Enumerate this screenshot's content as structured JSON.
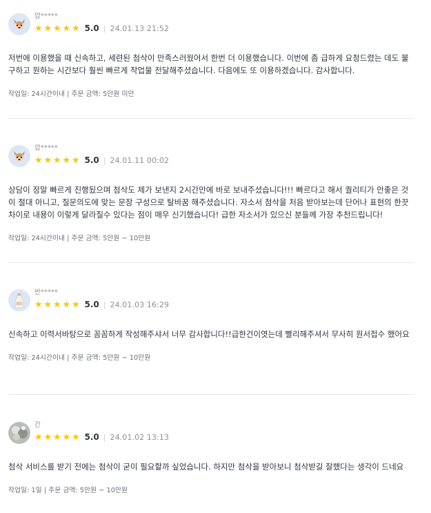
{
  "reviews": [
    {
      "user": "얍*****",
      "avatar": "dog-avatar-icon",
      "score": "5.0",
      "date": "24.01.13 21:52",
      "content": "저번에 이용했을 때 신속하고, 세련된 첨삭이 만족스러웠어서 한번 더 이용했습니다. 이번에 좀 급하게 요청드렸는 데도 불구하고 원하는 시간보다 훨씬 빠르게 작업물 전달해주셨습니다. 다음에도 또 이용하겠습니다. 감사합니다.",
      "info": "작업일: 24시간이내 | 주문 금액: 5만원 미만"
    },
    {
      "user": "얍*****",
      "avatar": "dog-avatar-icon",
      "score": "5.0",
      "date": "24.01.11 00:02",
      "content": "상담이 정말 빠르게 진행됬으며 첨삭도 제가 보낸지 2시간만에 바로 보내주셨습니다!!! 빠르다고 해서 퀄리티가 안좋은 것이 절대 아니고, 질문의도에 맞는 문장 구성으로 탈바꿈 해주셨습니다. 자소서 첨삭을 처음 받아보는데 단어나 표현의 한끗차이로 내용이 이렇게 달라질수 있다는 점이 매우 신기했습니다! 급한 자소서가 있으신 분들께 가장 추천드립니다!",
      "info": "작업일: 24시간이내 | 주문 금액: 5만원 ~ 10만원"
    },
    {
      "user": "반*****",
      "avatar": "milk-bottle-avatar-icon",
      "score": "5.0",
      "date": "24.01.03 16:29",
      "content": "신속하고 이력서바탕으로 꼼꼼하게 작성해주샤서 너무 감사합니다!!급한건이엿는데 빨리해주셔서 무사히 원서접수 했어요",
      "info": "작업일: 24시간이내 | 주문 금액: 5만원 ~ 10만원"
    },
    {
      "user": "간",
      "avatar": "photo-avatar-icon",
      "score": "5.0",
      "date": "24.01.02 13:13",
      "content": "첨삭 서비스를 받기 전에는 첨삭이 굳이 필요할까 싶었습니다. 하지만 첨삭을 받아보니 첨삭받길 잘했다는 생각이 드네요",
      "info": "작업일: 1일 | 주문 금액: 5만원 ~ 10만원"
    }
  ],
  "star_color": "#ffc400"
}
